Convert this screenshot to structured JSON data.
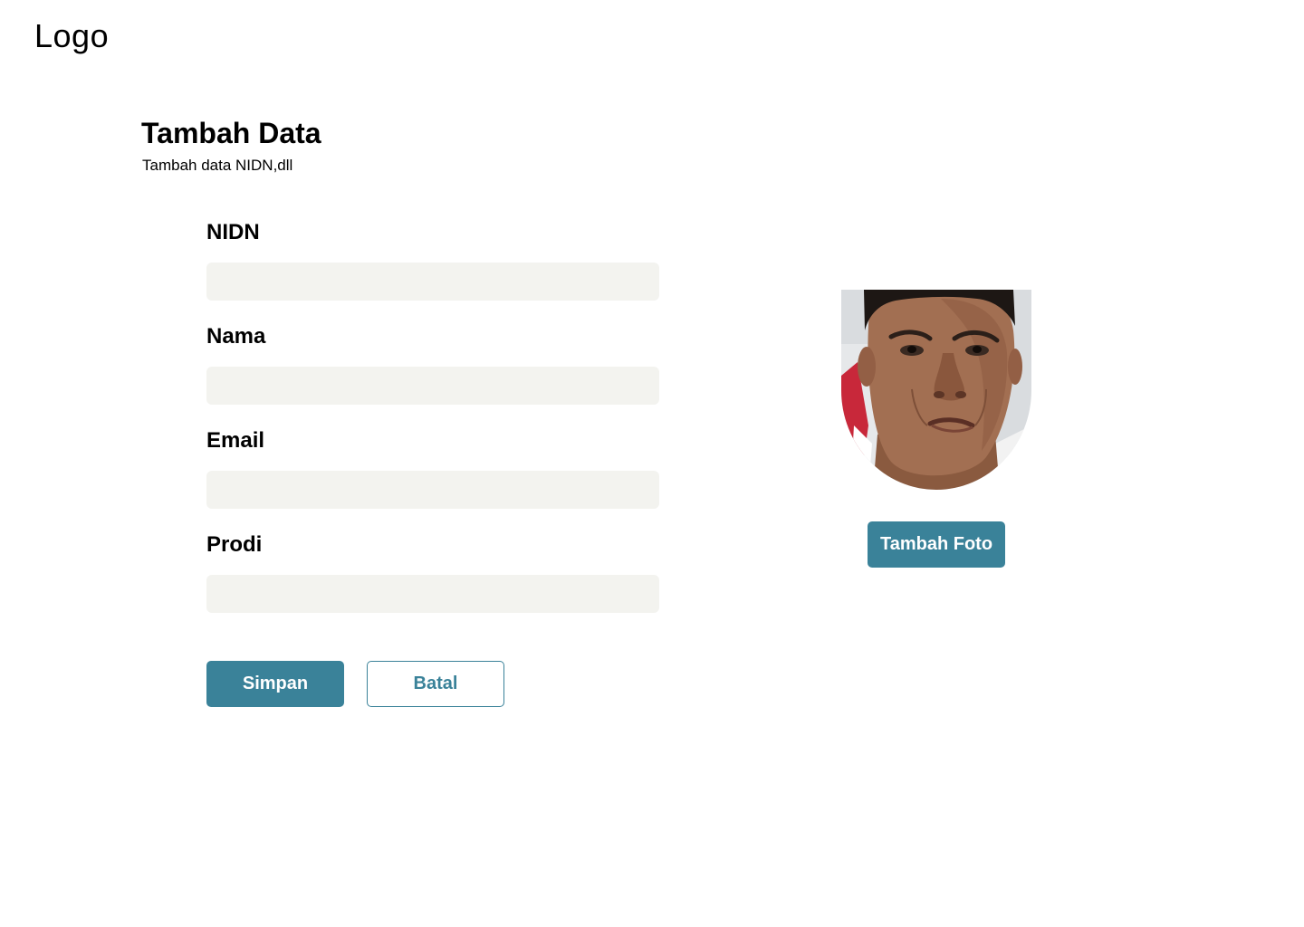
{
  "header": {
    "logo_text": "Logo"
  },
  "page": {
    "title": "Tambah Data",
    "subtitle": "Tambah data NIDN,dll"
  },
  "form": {
    "fields": [
      {
        "label": "NIDN",
        "value": "",
        "placeholder": ""
      },
      {
        "label": "Nama",
        "value": "",
        "placeholder": ""
      },
      {
        "label": "Email",
        "value": "",
        "placeholder": ""
      },
      {
        "label": "Prodi",
        "value": "",
        "placeholder": ""
      }
    ],
    "save_label": "Simpan",
    "cancel_label": "Batal"
  },
  "photo": {
    "add_photo_label": "Tambah Foto"
  },
  "colors": {
    "accent": "#3a8299",
    "input_bg": "#f3f3ef"
  }
}
